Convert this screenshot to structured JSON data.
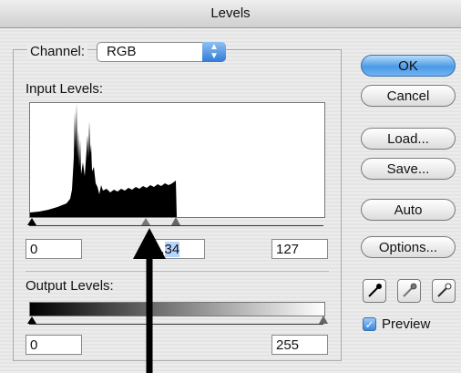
{
  "window": {
    "title": "Levels"
  },
  "channel": {
    "label": "Channel:",
    "value": "RGB"
  },
  "input_levels": {
    "label": "Input Levels:",
    "black": "0",
    "mid_prefix": "1.",
    "mid_selected": "34",
    "white": "127"
  },
  "output_levels": {
    "label": "Output Levels:",
    "black": "0",
    "white": "255"
  },
  "buttons": {
    "ok": "OK",
    "cancel": "Cancel",
    "load": "Load...",
    "save": "Save...",
    "auto": "Auto",
    "options": "Options..."
  },
  "preview": {
    "label": "Preview",
    "checked": true
  },
  "eyedroppers": [
    "black-eyedropper-icon",
    "gray-eyedropper-icon",
    "white-eyedropper-icon"
  ],
  "colors": {
    "accent": "#4b9ae6",
    "selection": "#b5d5ff"
  }
}
